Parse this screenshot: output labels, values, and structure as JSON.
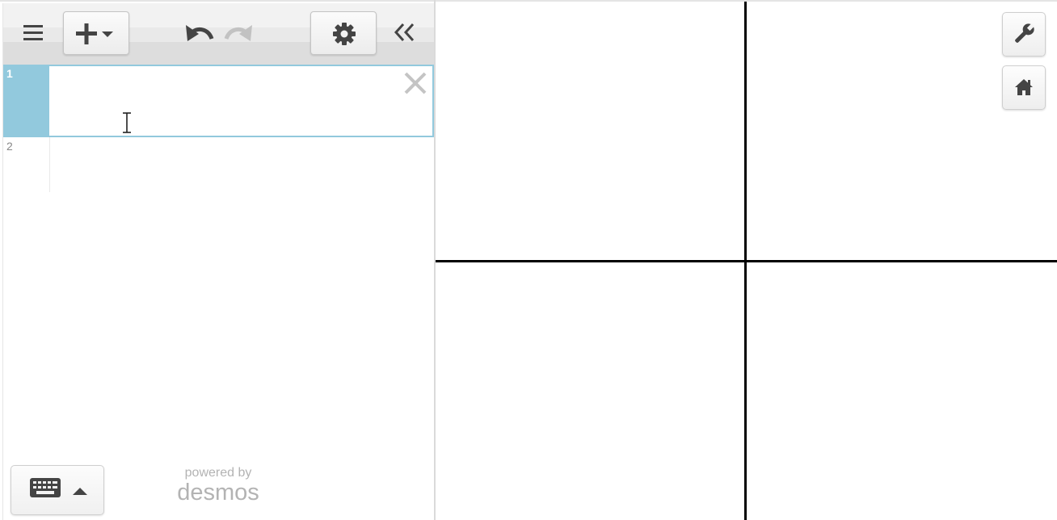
{
  "toolbar": {
    "menu_icon": "hamburger-icon",
    "add_icon": "plus-dropdown-icon",
    "undo_icon": "undo-icon",
    "redo_icon": "redo-icon",
    "settings_icon": "gear-icon",
    "collapse_icon": "double-chevron-left-icon"
  },
  "expressions": [
    {
      "number": "1",
      "value": "",
      "active": true
    },
    {
      "number": "2",
      "value": "",
      "active": false
    }
  ],
  "keypad": {
    "keyboard_icon": "keyboard-icon",
    "toggle_icon": "caret-up-icon"
  },
  "branding": {
    "powered_by": "powered by",
    "brand": "desmos"
  },
  "graph": {
    "wrench_icon": "wrench-icon",
    "home_icon": "home-icon"
  },
  "colors": {
    "active_accent": "#92c9dd",
    "icon": "#444444",
    "brand_gray": "#b3b3b3",
    "axis": "#000000"
  }
}
